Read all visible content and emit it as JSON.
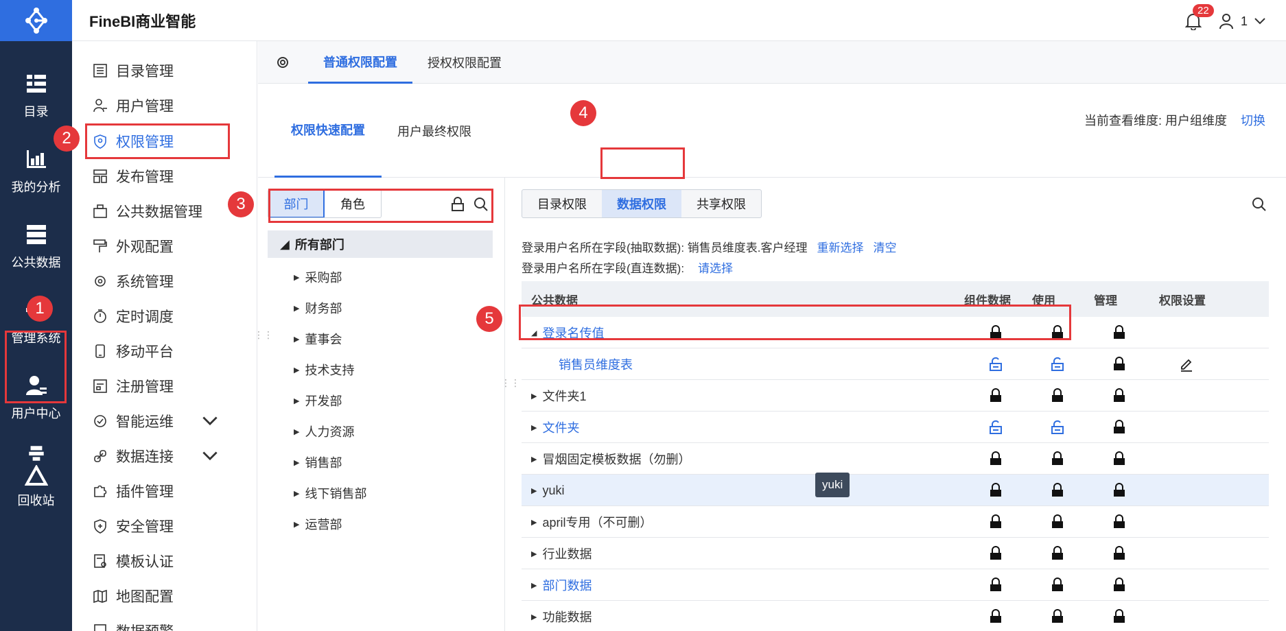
{
  "app": {
    "brand": "FineBI商业智能",
    "notification_count": "22",
    "user_name": "1"
  },
  "leftnav": [
    {
      "label": "目录",
      "icon": "catalog-icon"
    },
    {
      "label": "我的分析",
      "icon": "analysis-icon"
    },
    {
      "label": "公共数据",
      "icon": "public-data-icon"
    },
    {
      "label": "管理系统",
      "icon": "gear-icon"
    },
    {
      "label": "用户中心",
      "icon": "user-center-icon"
    },
    {
      "label": "回收站",
      "icon": "recycle-icon"
    }
  ],
  "menu": [
    {
      "label": "目录管理"
    },
    {
      "label": "用户管理"
    },
    {
      "label": "权限管理"
    },
    {
      "label": "发布管理"
    },
    {
      "label": "公共数据管理"
    },
    {
      "label": "外观配置"
    },
    {
      "label": "系统管理"
    },
    {
      "label": "定时调度"
    },
    {
      "label": "移动平台"
    },
    {
      "label": "注册管理"
    },
    {
      "label": "智能运维"
    },
    {
      "label": "数据连接"
    },
    {
      "label": "插件管理"
    },
    {
      "label": "安全管理"
    },
    {
      "label": "模板认证"
    },
    {
      "label": "地图配置"
    },
    {
      "label": "数据预警"
    }
  ],
  "tabs1": [
    "普通权限配置",
    "授权权限配置"
  ],
  "tabs2": [
    "权限快速配置",
    "用户最终权限"
  ],
  "dimension": {
    "label": "当前查看维度:",
    "value": "用户组维度",
    "switch": "切换"
  },
  "segment": [
    "部门",
    "角色"
  ],
  "tree": {
    "root": "所有部门",
    "items": [
      "采购部",
      "财务部",
      "董事会",
      "技术支持",
      "开发部",
      "人力资源",
      "销售部",
      "线下销售部",
      "运营部"
    ]
  },
  "subtabs": [
    "目录权限",
    "数据权限",
    "共享权限"
  ],
  "info": {
    "line1_label": "登录用户名所在字段(抽取数据): 销售员维度表.客户经理",
    "line1_reselect": "重新选择",
    "line1_clear": "清空",
    "line2_label": "登录用户名所在字段(直连数据):",
    "line2_select": "请选择"
  },
  "table": {
    "headers": [
      "公共数据",
      "组件数据",
      "使用",
      "管理",
      "权限设置"
    ],
    "rows": [
      {
        "name": "登录名传值",
        "locks": [
          "closed",
          "closed",
          "closed"
        ]
      },
      {
        "name": "销售员维度表",
        "locks": [
          "open",
          "open",
          "closed"
        ]
      },
      {
        "name": "文件夹1",
        "locks": [
          "closed",
          "closed",
          "closed"
        ]
      },
      {
        "name": "文件夹",
        "locks": [
          "open",
          "open",
          "closed"
        ]
      },
      {
        "name": "冒烟固定模板数据（勿删）",
        "locks": [
          "closed",
          "closed",
          "closed"
        ]
      },
      {
        "name": "yuki",
        "locks": [
          "closed",
          "closed",
          "closed"
        ]
      },
      {
        "name": "april专用（不可删）",
        "locks": [
          "closed",
          "closed",
          "closed"
        ]
      },
      {
        "name": "行业数据",
        "locks": [
          "closed",
          "closed",
          "closed"
        ]
      },
      {
        "name": "部门数据",
        "locks": [
          "closed",
          "closed",
          "closed"
        ]
      },
      {
        "name": "功能数据",
        "locks": [
          "closed",
          "closed",
          "closed"
        ]
      }
    ]
  },
  "tooltip": "yuki",
  "markers": [
    "1",
    "2",
    "3",
    "4",
    "5"
  ],
  "colors": {
    "accent": "#2f6ee0",
    "nav_bg": "#1c2d4a",
    "marker": "#e5383b"
  }
}
